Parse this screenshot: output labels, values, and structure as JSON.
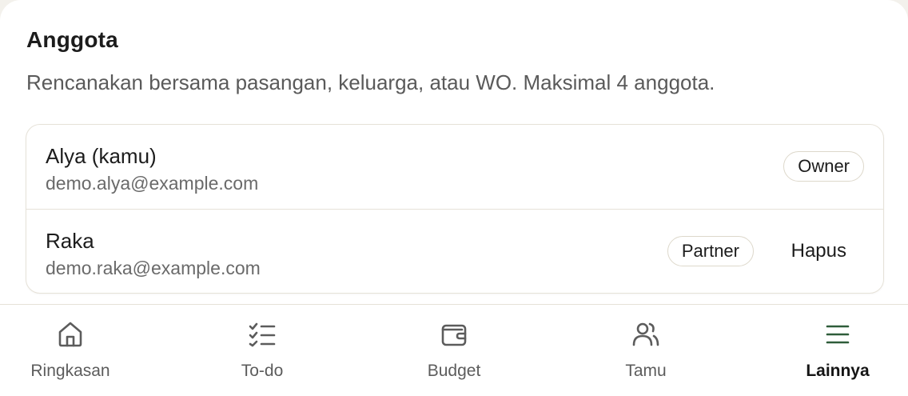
{
  "section": {
    "title": "Anggota",
    "description": "Rencanakan bersama pasangan, keluarga, atau WO. Maksimal 4 anggota."
  },
  "members": [
    {
      "name": "Alya (kamu)",
      "email": "demo.alya@example.com",
      "role": "Owner"
    },
    {
      "name": "Raka",
      "email": "demo.raka@example.com",
      "role": "Partner",
      "action": "Hapus"
    }
  ],
  "tabs": [
    {
      "label": "Ringkasan",
      "icon": "home-icon"
    },
    {
      "label": "To-do",
      "icon": "checklist-icon"
    },
    {
      "label": "Budget",
      "icon": "wallet-icon"
    },
    {
      "label": "Tamu",
      "icon": "users-icon"
    },
    {
      "label": "Lainnya",
      "icon": "menu-icon",
      "active": true
    }
  ],
  "colors": {
    "accent": "#2f5d3a",
    "icon": "#5c5c5c",
    "border": "#e6e2d8"
  }
}
